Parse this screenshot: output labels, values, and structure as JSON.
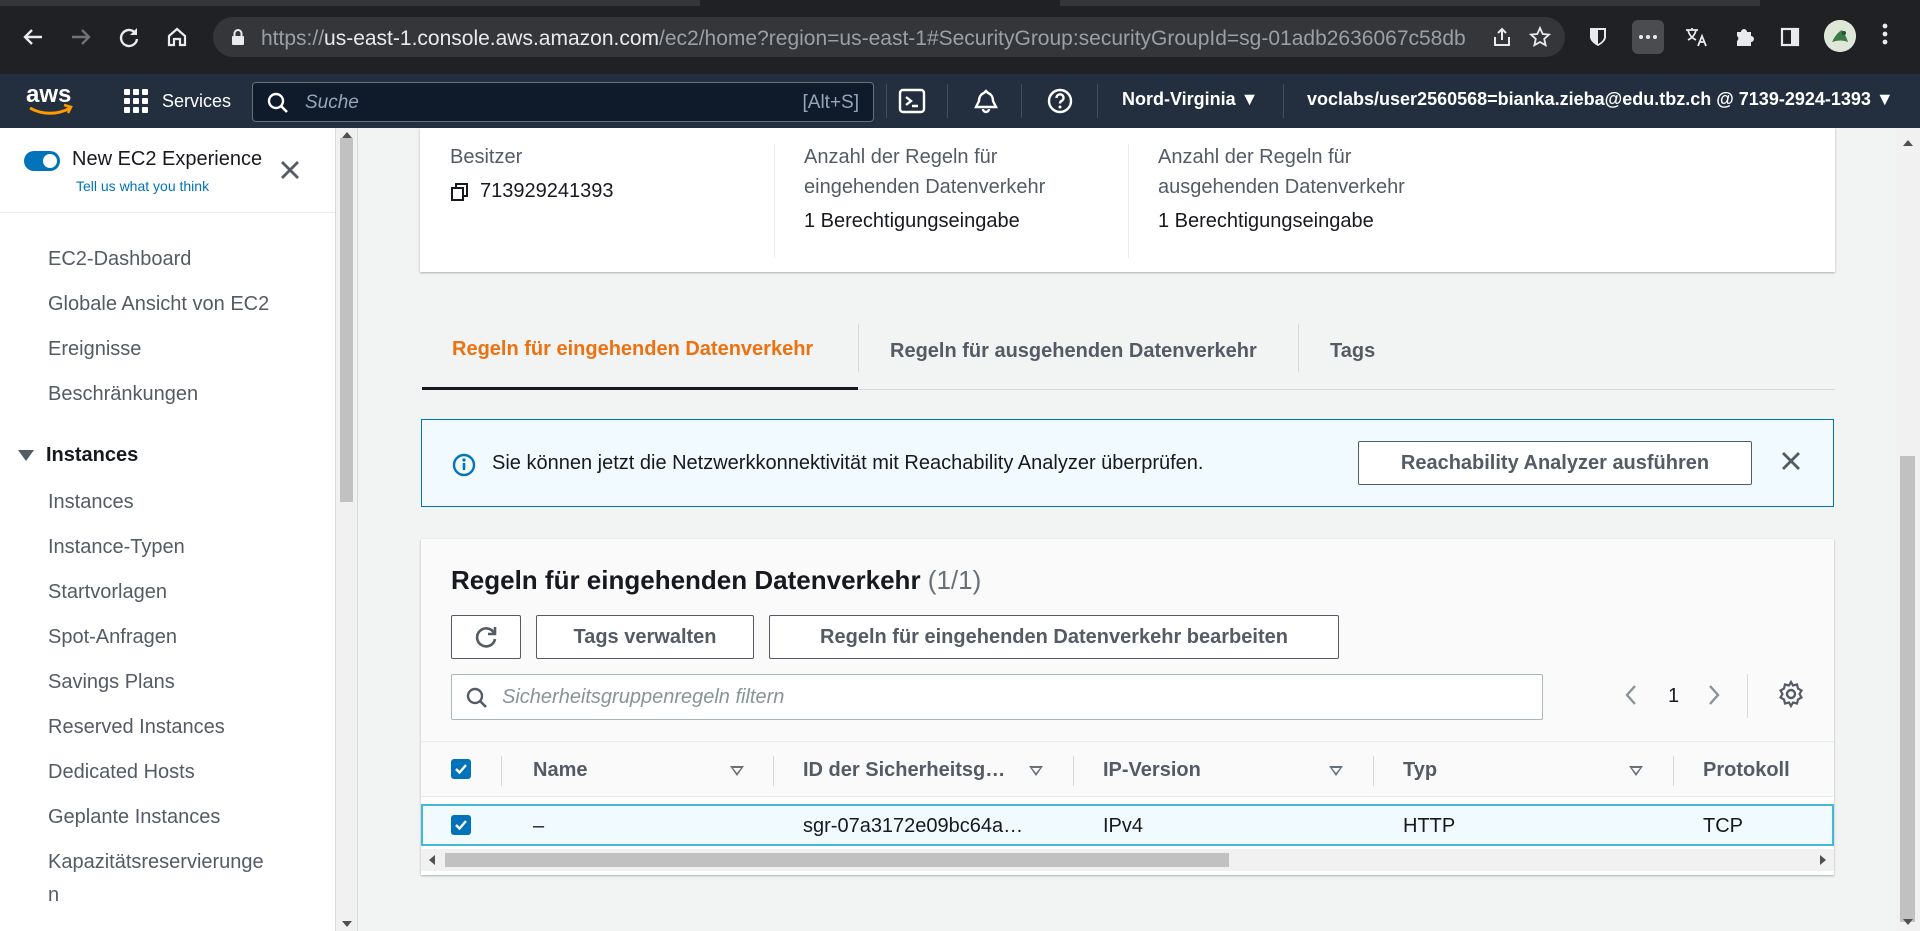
{
  "browser": {
    "url_prefix": "https://",
    "url_host": "us-east-1.console.aws.amazon.com",
    "url_path": "/ec2/home?region=us-east-1#SecurityGroup:securityGroupId=sg-01adb2636067c58db"
  },
  "aws_nav": {
    "logo": "aws",
    "services_label": "Services",
    "search_placeholder": "Suche",
    "search_shortcut": "[Alt+S]",
    "region": "Nord-Virginia ▼",
    "account": "voclabs/user2560568=bianka.zieba@edu.tbz.ch @ 7139-2924-1393 ▼"
  },
  "sidebar": {
    "toggle_label": "New EC2 Experience",
    "toggle_sub": "Tell us what you think",
    "items": [
      {
        "label": "EC2-Dashboard"
      },
      {
        "label": "Globale Ansicht von EC2"
      },
      {
        "label": "Ereignisse"
      },
      {
        "label": "Beschränkungen"
      }
    ],
    "section": "Instances",
    "section_items": [
      {
        "label": "Instances"
      },
      {
        "label": "Instance-Typen"
      },
      {
        "label": "Startvorlagen"
      },
      {
        "label": "Spot-Anfragen"
      },
      {
        "label": "Savings Plans"
      },
      {
        "label": "Reserved Instances"
      },
      {
        "label": "Dedicated Hosts"
      },
      {
        "label": "Geplante Instances"
      },
      {
        "label": "Kapazitätsreservierunge"
      },
      {
        "label": "n"
      }
    ]
  },
  "details": {
    "owner_label": "Besitzer",
    "owner_value": "713929241393",
    "inbound_label_1": "Anzahl der Regeln für",
    "inbound_label_2": "eingehenden Datenverkehr",
    "inbound_value": "1 Berechtigungseingabe",
    "outbound_label_1": "Anzahl der Regeln für",
    "outbound_label_2": "ausgehenden Datenverkehr",
    "outbound_value": "1 Berechtigungseingabe"
  },
  "tabs": [
    {
      "label": "Regeln für eingehenden Datenverkehr",
      "active": true
    },
    {
      "label": "Regeln für ausgehenden Datenverkehr",
      "active": false
    },
    {
      "label": "Tags",
      "active": false
    }
  ],
  "flash": {
    "text": "Sie können jetzt die Netzwerkkonnektivität mit Reachability Analyzer überprüfen.",
    "button": "Reachability Analyzer ausführen"
  },
  "table": {
    "title": "Regeln für eingehenden Datenverkehr",
    "count": "(1/1)",
    "manage_tags": "Tags verwalten",
    "edit_rules": "Regeln für eingehenden Datenverkehr bearbeiten",
    "filter_placeholder": "Sicherheitsgruppenregeln filtern",
    "page": "1",
    "columns": [
      "Name",
      "ID der Sicherheitsg…",
      "IP-Version",
      "Typ",
      "Protokoll"
    ],
    "rows": [
      {
        "name": "–",
        "id": "sgr-07a3172e09bc64a…",
        "ip_version": "IPv4",
        "type": "HTTP",
        "protocol": "TCP"
      }
    ]
  },
  "colors": {
    "accent_orange": "#ec7211",
    "aws_navy": "#232f3e",
    "link_blue": "#0073bb"
  }
}
